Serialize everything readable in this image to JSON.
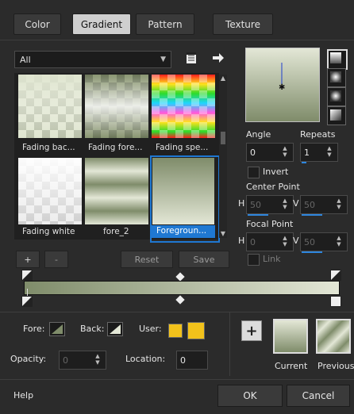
{
  "tabs": [
    {
      "label": "Color",
      "active": false
    },
    {
      "label": "Gradient",
      "active": true
    },
    {
      "label": "Pattern",
      "active": false
    },
    {
      "label": "Texture",
      "active": false
    }
  ],
  "category": {
    "selected": "All"
  },
  "thumbnails": [
    {
      "label": "Fading bac...",
      "selected": false
    },
    {
      "label": "Fading fore...",
      "selected": false
    },
    {
      "label": "Fading spe...",
      "selected": false
    },
    {
      "label": "Fading white",
      "selected": false
    },
    {
      "label": "fore_2",
      "selected": false
    },
    {
      "label": "Foregroun...",
      "selected": true
    }
  ],
  "list_buttons": {
    "add": "+",
    "remove": "-",
    "reset": "Reset",
    "save": "Save"
  },
  "angle": {
    "label": "Angle",
    "value": "0"
  },
  "repeats": {
    "label": "Repeats",
    "value": "1"
  },
  "invert": {
    "label": "Invert",
    "checked": false
  },
  "center_point": {
    "label": "Center Point",
    "h_label": "H",
    "h_value": "50",
    "v_label": "V",
    "v_value": "50"
  },
  "focal_point": {
    "label": "Focal Point",
    "h_label": "H",
    "h_value": "0",
    "v_label": "V",
    "v_value": "50"
  },
  "link": {
    "label": "Link",
    "checked": false
  },
  "stops": {
    "fore_label": "Fore:",
    "back_label": "Back:",
    "user_label": "User:",
    "opacity_label": "Opacity:",
    "opacity_value": "0",
    "location_label": "Location:",
    "location_value": "0"
  },
  "preview": {
    "current_label": "Current",
    "previous_label": "Previous",
    "add": "+"
  },
  "footer": {
    "help": "Help",
    "ok": "OK",
    "cancel": "Cancel"
  },
  "colors": {
    "gradient_dark": "#7f8c6a",
    "gradient_light": "#e3e7d6",
    "selection": "#1f78d2",
    "user_swatch": "#f2c21b"
  }
}
